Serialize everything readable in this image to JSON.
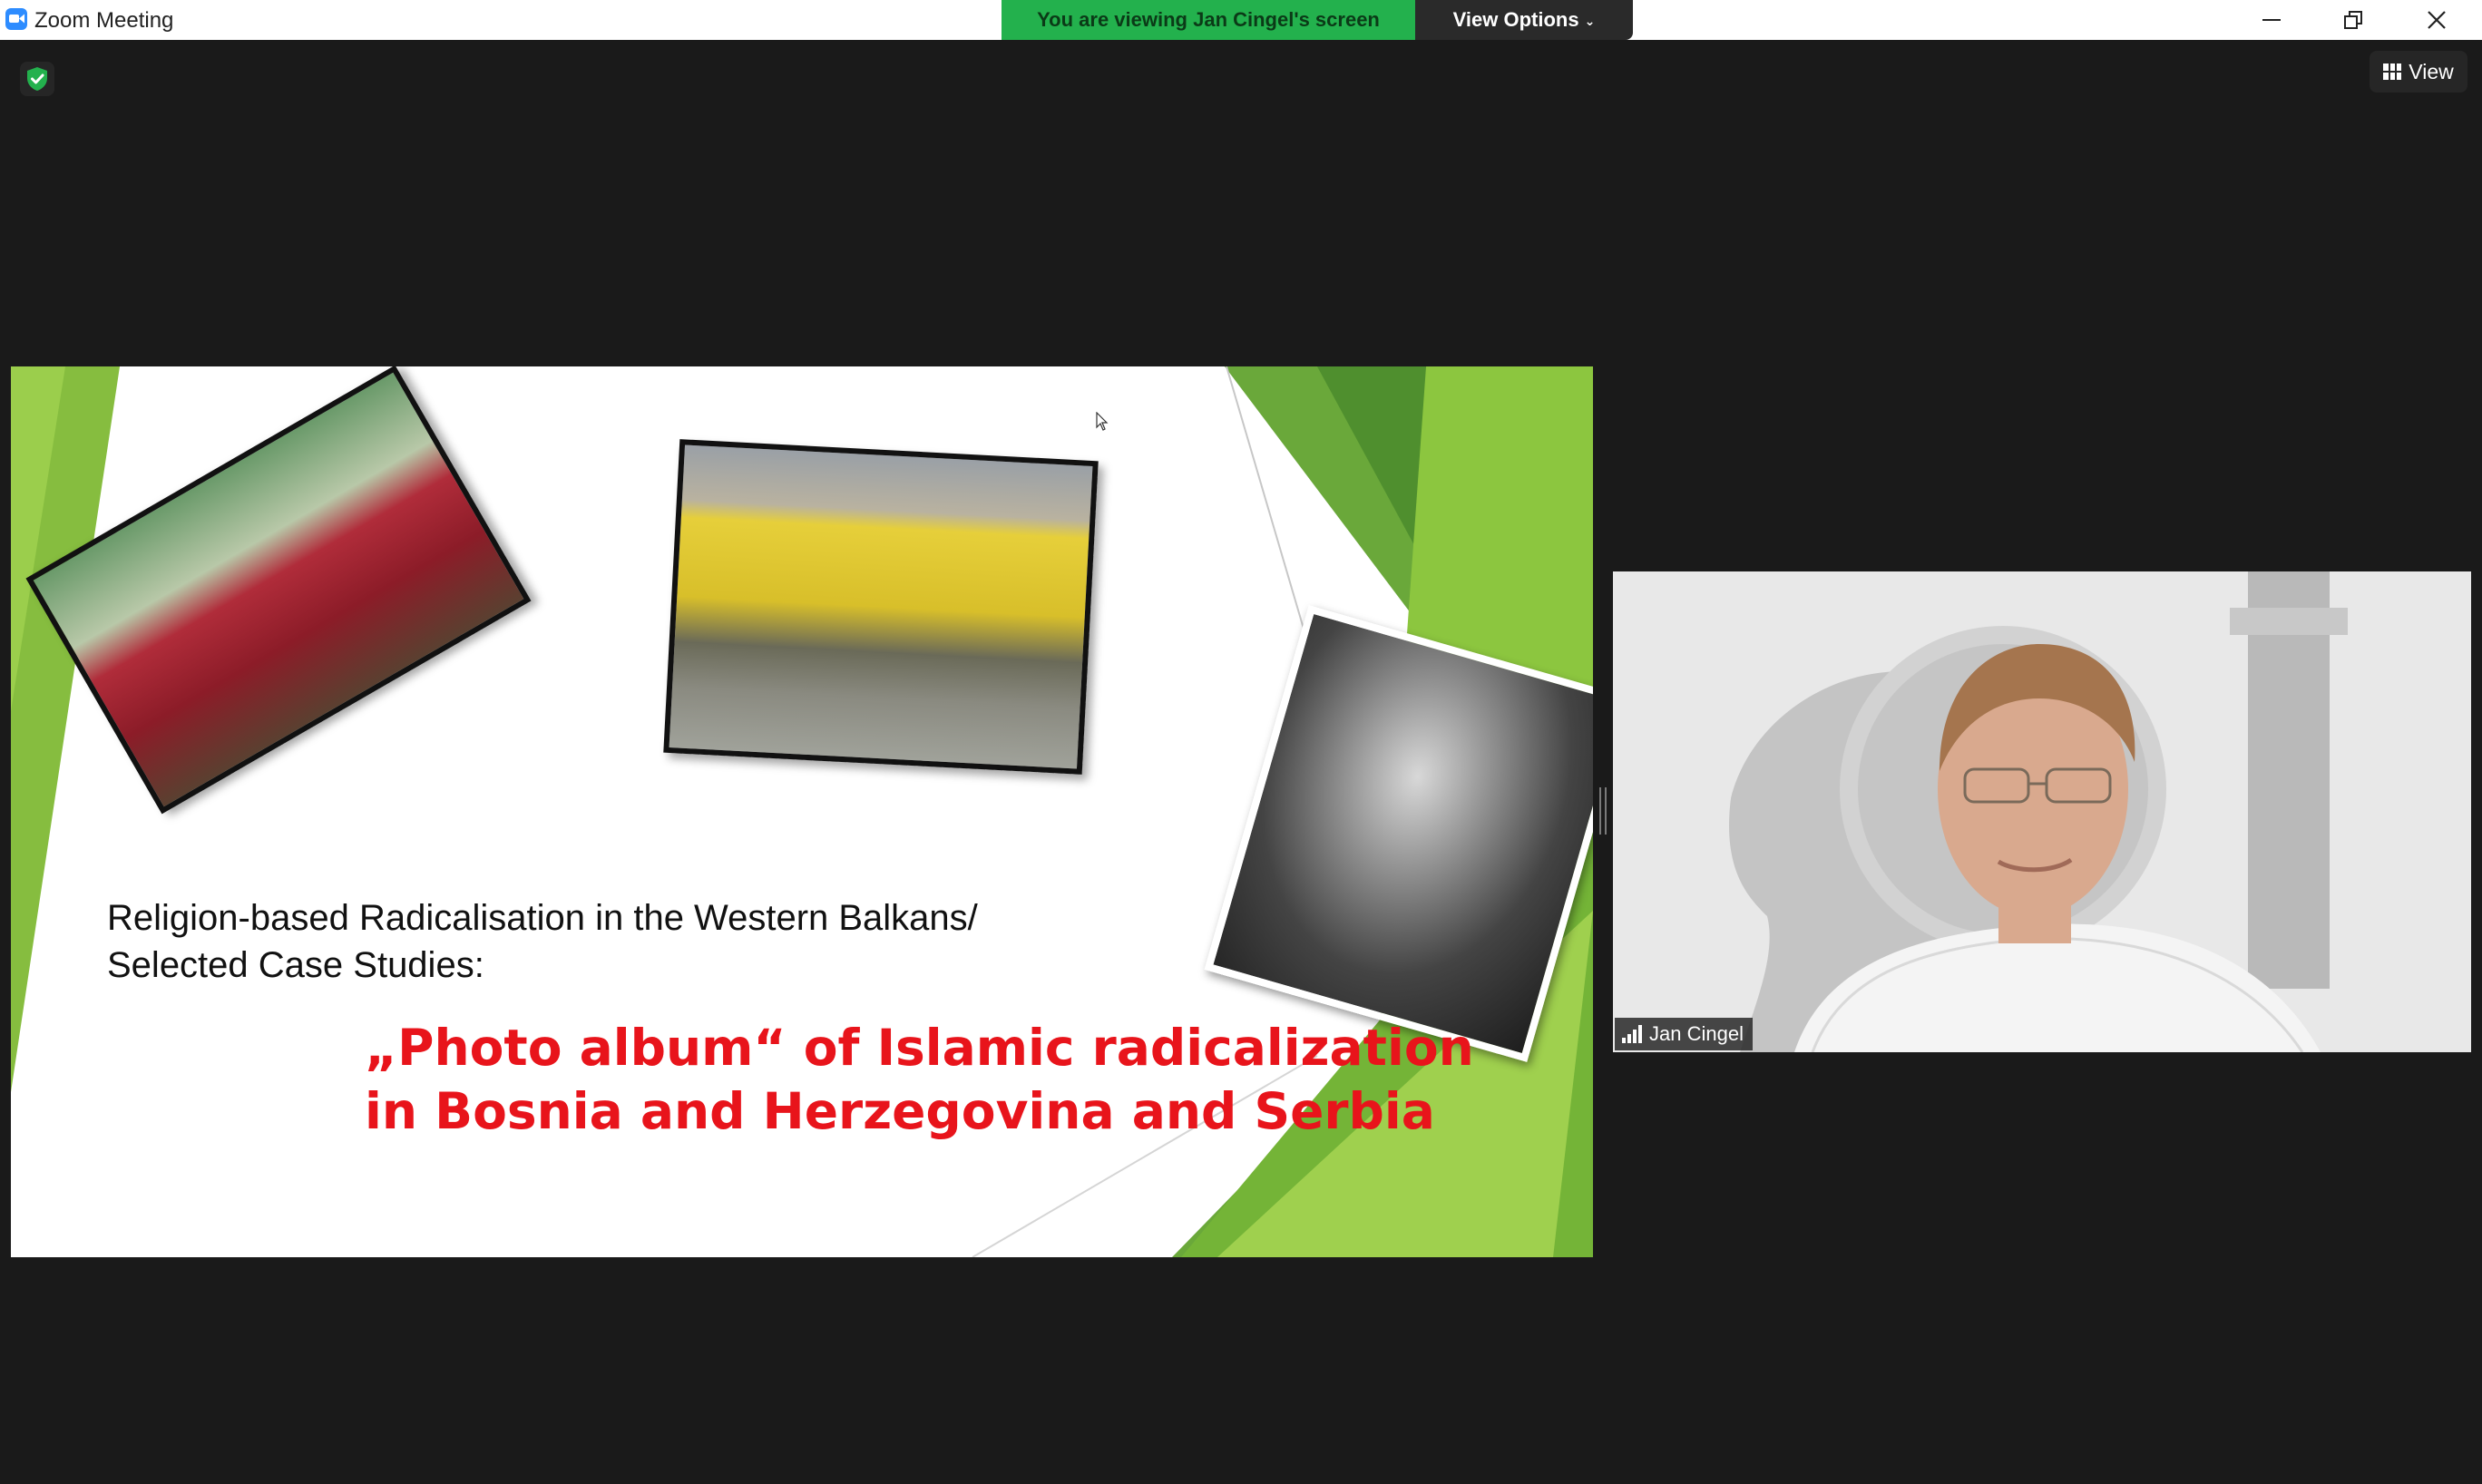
{
  "window": {
    "title": "Zoom Meeting",
    "share_banner": "You are viewing Jan Cingel's screen",
    "view_options_label": "View Options"
  },
  "controls": {
    "view_label": "View"
  },
  "slide": {
    "title_line1": "Religion-based Radicalisation in the Western Balkans/",
    "title_line2": "Selected Case Studies:",
    "subtitle_line1": "„Photo album“ of Islamic radicalization",
    "subtitle_line2": "in Bosnia and Herzegovina and Serbia"
  },
  "participant": {
    "name": "Jan Cingel"
  },
  "colors": {
    "banner_green": "#23b14d",
    "subtitle_red": "#e8141b",
    "accent_green": "#7cb637",
    "zoom_blue": "#2d8cff"
  }
}
